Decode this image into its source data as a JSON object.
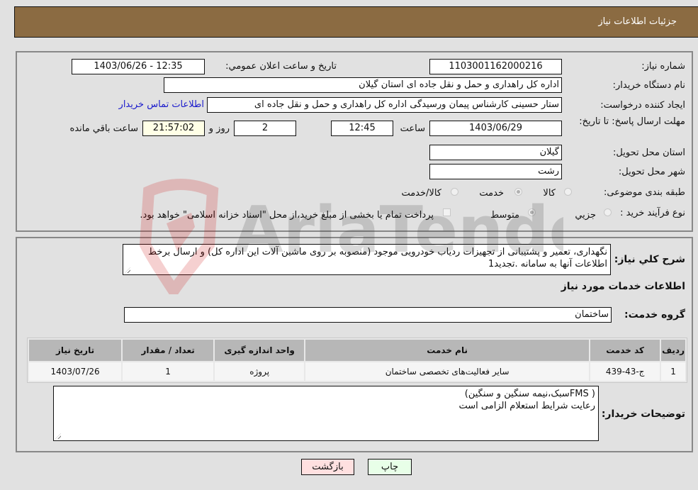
{
  "header": {
    "title": "جزئیات اطلاعات نیاز"
  },
  "details": {
    "need_number_label": "شماره نیاز:",
    "need_number": "1103001162000216",
    "announce_label": "تاریخ و ساعت اعلان عمومي:",
    "announce_value": "1403/06/26 - 12:35",
    "buyer_org_label": "نام دستگاه خریدار:",
    "buyer_org": "اداره کل راهداری و حمل و نقل جاده ای استان گیلان",
    "creator_label": "ایجاد کننده درخواست:",
    "creator": "ستار حسینی کارشناس پیمان ورسیدگی اداره کل راهداری و حمل و نقل جاده ای",
    "contact_link": "اطلاعات تماس خریدار",
    "deadline_label": "مهلت ارسال پاسخ: تا تاریخ:",
    "deadline_date": "1403/06/29",
    "time_label": "ساعت",
    "deadline_time": "12:45",
    "days_value": "2",
    "days_label": "روز و",
    "remaining_time": "21:57:02",
    "remaining_label": "ساعت باقي مانده",
    "province_label": "استان محل تحویل:",
    "province": "گیلان",
    "city_label": "شهر محل تحویل:",
    "city": "رشت",
    "category_label": "طبقه بندی موضوعی:",
    "category_options": [
      {
        "label": "کالا",
        "checked": false
      },
      {
        "label": "خدمت",
        "checked": true
      },
      {
        "label": "کالا/خدمت",
        "checked": false
      }
    ],
    "process_label": "نوع فرآیند خرید :",
    "process_options": [
      {
        "label": "جزیي",
        "checked": false
      },
      {
        "label": "متوسط",
        "checked": true
      }
    ],
    "treasury_checkbox_label": "پرداخت تمام یا بخشی از مبلغ خرید،از محل \"اسناد خزانه اسلامی\" خواهد بود."
  },
  "description": {
    "label": "شرح کلي نیاز:",
    "text": "نگهداری، تعمیر و پشتیبانی از تجهیزات ردیاب خودرویی موجود (منصوبه بر روی ماشین آلات این اداره کل) و ارسال برخط اطلاعات آنها به سامانه .تجدید1"
  },
  "services": {
    "section_title": "اطلاعات خدمات مورد نیاز",
    "group_label": "گروه خدمت:",
    "group_value": "ساختمان",
    "columns": [
      "ردیف",
      "کد خدمت",
      "نام خدمت",
      "واحد اندازه گیری",
      "تعداد / مقدار",
      "تاریخ نیاز"
    ],
    "rows": [
      [
        "1",
        "ج-43-439",
        "سایر فعالیت‌های تخصصی ساختمان",
        "پروژه",
        "1",
        "1403/07/26"
      ]
    ]
  },
  "buyer_notes": {
    "label": "توضیحات خریدار:",
    "line1": "( FMSسبک،نیمه سنگین و سنگین)",
    "line2": "رعایت شرایط استعلام الزامی است"
  },
  "buttons": {
    "print": "چاپ",
    "back": "بازگشت"
  },
  "watermark": {
    "text": "AriaTender.neT"
  },
  "colors": {
    "header_bg": "#8b6b42",
    "link": "#1a1acc",
    "back_btn": "#ffe0e0",
    "print_btn": "#e8ffe8",
    "remaining_bg": "#ffffe6"
  }
}
